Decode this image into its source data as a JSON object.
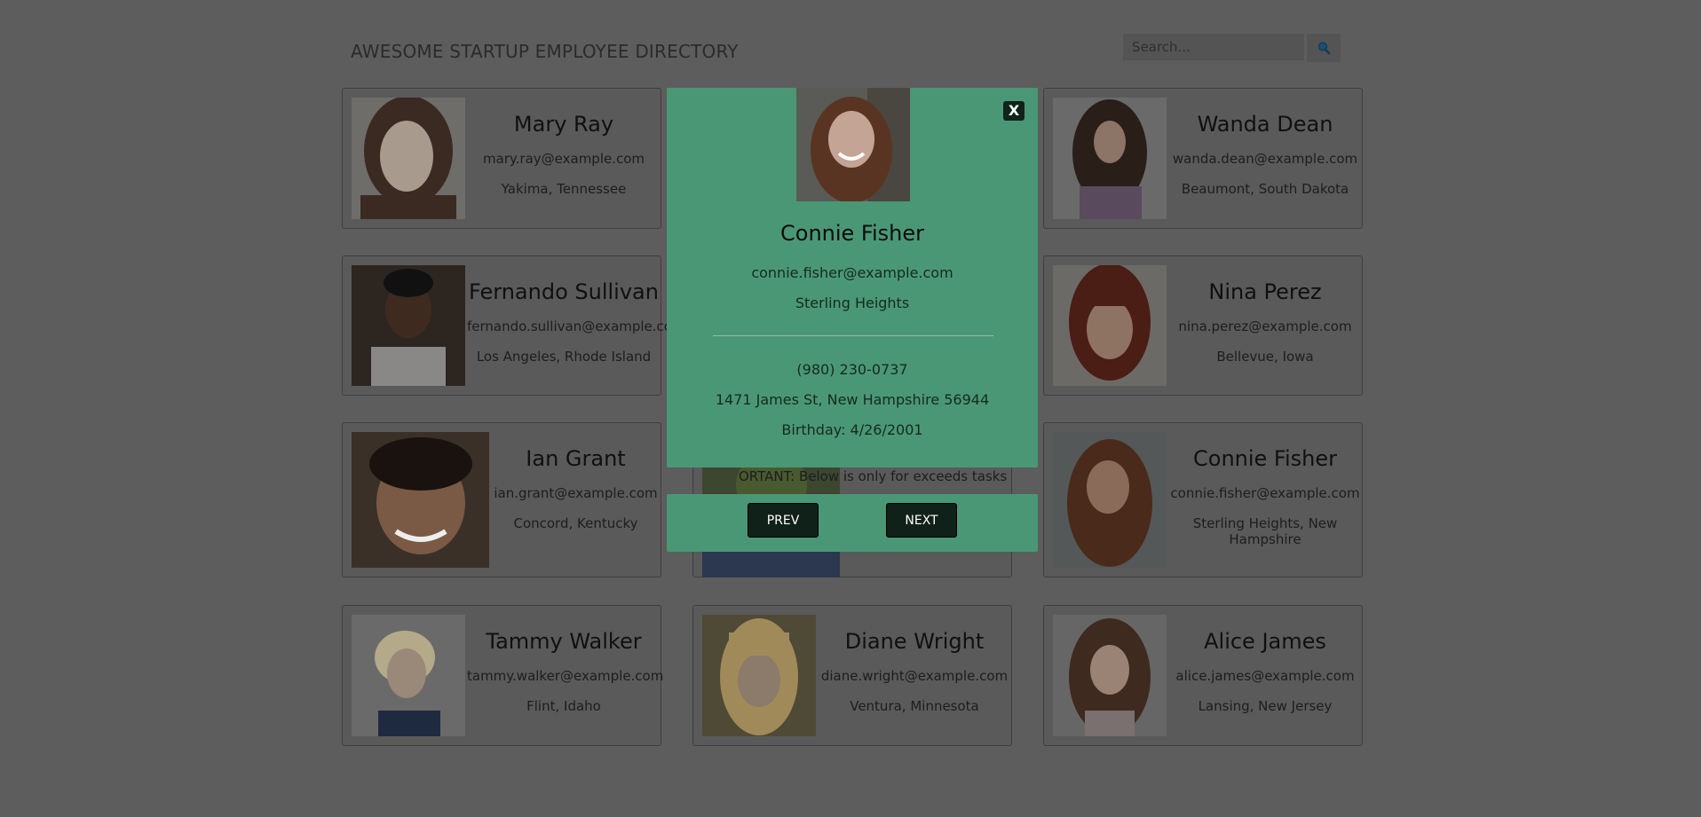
{
  "header": {
    "title": "AWESOME STARTUP EMPLOYEE DIRECTORY"
  },
  "search": {
    "placeholder": "Search...",
    "value": "",
    "icon": "search-icon"
  },
  "employees": [
    {
      "name": "Mary Ray",
      "email": "mary.ray@example.com",
      "location": "Yakima, Tennessee"
    },
    {
      "name": "Wanda Dean",
      "email": "wanda.dean@example.com",
      "location": "Beaumont, South Dakota"
    },
    {
      "name": "Fernando Sullivan",
      "email": "fernando.sullivan@example.co",
      "location": "Los Angeles, Rhode Island"
    },
    {
      "name": "Nina Perez",
      "email": "nina.perez@example.com",
      "location": "Bellevue, Iowa"
    },
    {
      "name": "Ian Grant",
      "email": "ian.grant@example.com",
      "location": "Concord, Kentucky"
    },
    {
      "name": "Connie Fisher",
      "email": "connie.fisher@example.com",
      "location": "Sterling Heights, New Hampshire"
    },
    {
      "name": "Tammy Walker",
      "email": "tammy.walker@example.com",
      "location": "Flint, Idaho"
    },
    {
      "name": "Diane Wright",
      "email": "diane.wright@example.com",
      "location": "Ventura, Minnesota"
    },
    {
      "name": "Alice James",
      "email": "alice.james@example.com",
      "location": "Lansing, New Jersey"
    }
  ],
  "partial_text": "ORTANT: Below is only for exceeds tasks",
  "modal": {
    "close_label": "X",
    "name": "Connie Fisher",
    "email": "connie.fisher@example.com",
    "city": "Sterling Heights",
    "phone": "(980) 230-0737",
    "address": "1471 James St, New Hampshire 56944",
    "birthday": "Birthday: 4/26/2001"
  },
  "nav": {
    "prev_label": "PREV",
    "next_label": "NEXT"
  },
  "colors": {
    "modal_bg": "#4a9776",
    "button_bg": "#10211a",
    "overlay_bg": "#5d5d5d"
  }
}
